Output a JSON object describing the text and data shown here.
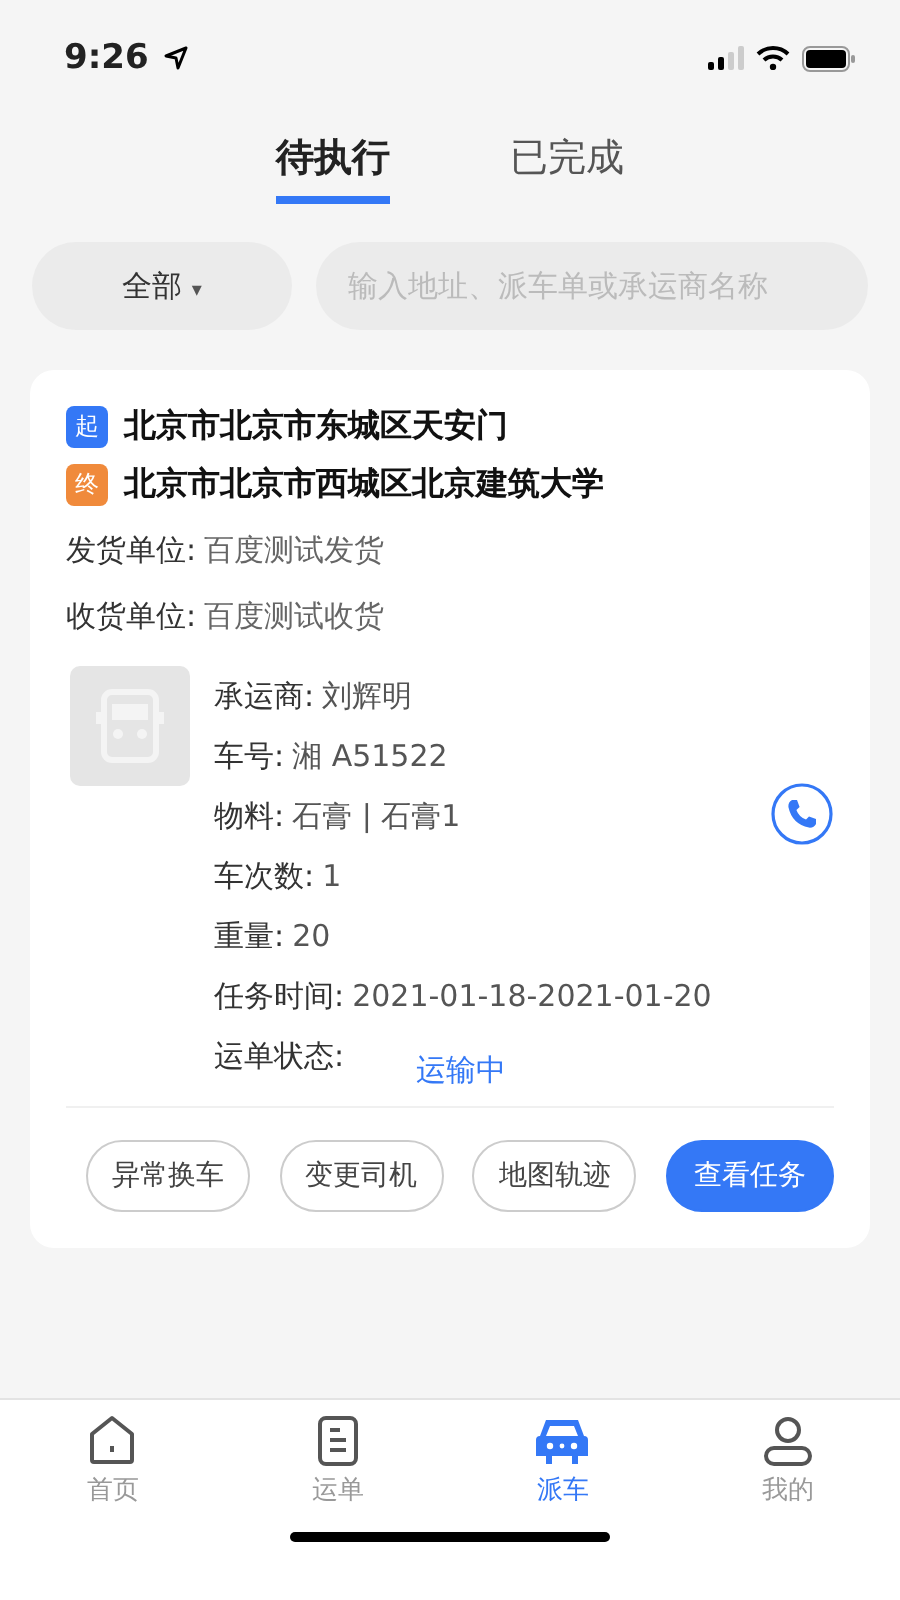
{
  "status_bar": {
    "time": "9:26"
  },
  "tabs": [
    {
      "label": "待执行",
      "selected": true
    },
    {
      "label": "已完成",
      "selected": false
    }
  ],
  "filter": {
    "label": "全部",
    "caret": "▾"
  },
  "search": {
    "placeholder": "输入地址、派车单或承运商名称"
  },
  "card": {
    "route": [
      {
        "kind": "start",
        "tag": "起",
        "address": "北京市北京市东城区天安门"
      },
      {
        "kind": "end",
        "tag": "终",
        "address": "北京市北京市西城区北京建筑大学"
      }
    ],
    "parties": [
      {
        "label": "发货单位:",
        "value": "百度测试发货"
      },
      {
        "label": "收货单位:",
        "value": "百度测试收货"
      }
    ],
    "details": [
      {
        "kind": "plain",
        "label": "承运商:",
        "value": "刘辉明"
      },
      {
        "kind": "plain",
        "label": "车号:",
        "value": "湘 A51522"
      },
      {
        "kind": "plain",
        "label": "物料:",
        "value": "石膏 | 石膏1"
      },
      {
        "kind": "plain",
        "label": "车次数:",
        "value": "1"
      },
      {
        "kind": "plain",
        "label": "重量:",
        "value": "20"
      },
      {
        "kind": "plain",
        "label": "任务时间:",
        "value": "2021-01-18-2021-01-20"
      },
      {
        "kind": "status",
        "label": "运单状态:",
        "value": "运输中"
      }
    ],
    "actions": [
      {
        "kind": "outline",
        "label": "异常换车"
      },
      {
        "kind": "outline",
        "label": "变更司机"
      },
      {
        "kind": "outline",
        "label": "地图轨迹"
      },
      {
        "kind": "primary",
        "label": "查看任务"
      }
    ]
  },
  "bottom_nav": [
    {
      "kind": "home",
      "label": "首页",
      "selected": false
    },
    {
      "kind": "list",
      "label": "运单",
      "selected": false
    },
    {
      "kind": "car",
      "label": "派车",
      "selected": true
    },
    {
      "kind": "person",
      "label": "我的",
      "selected": false
    }
  ]
}
